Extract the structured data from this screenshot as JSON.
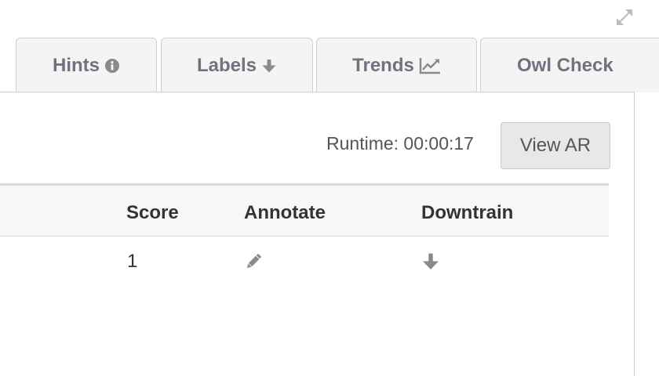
{
  "window": {
    "expand_icon": "expand-arrows-icon"
  },
  "tabs": [
    {
      "label": "Hints",
      "icon": "info-circle-icon"
    },
    {
      "label": "Labels",
      "icon": "arrow-down-icon"
    },
    {
      "label": "Trends",
      "icon": "line-chart-icon"
    },
    {
      "label": "Owl Check",
      "icon": ""
    }
  ],
  "toolbar": {
    "runtime_text": "Runtime: 00:00:17",
    "view_ar_label": "View AR"
  },
  "table": {
    "headers": [
      "Score",
      "Annotate",
      "Downtrain"
    ],
    "rows": [
      {
        "score": "1",
        "annotate_icon": "pencil-icon",
        "downtrain_icon": "arrow-down-icon"
      }
    ]
  },
  "colors": {
    "tab_text": "#6f7380",
    "tab_bg": "#f4f4f4",
    "icon_gray": "#8a8a8a",
    "header_bg": "#f7f7f7",
    "button_bg": "#e8e8e8"
  }
}
